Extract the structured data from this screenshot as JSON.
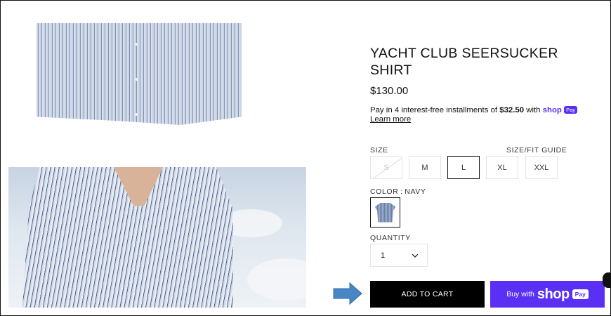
{
  "product": {
    "title_line1": "YACHT CLUB SEERSUCKER",
    "title_line2": "SHIRT",
    "price": "$130.00",
    "installments_pre": "Pay in 4 interest-free installments of ",
    "installments_amount": "$32.50",
    "installments_post": " with ",
    "installments_brand": "shop",
    "installments_brand_chip": "Pay",
    "learn_more": "Learn more"
  },
  "size": {
    "label": "SIZE",
    "guide_label": "SIZE/FIT GUIDE",
    "options": [
      {
        "label": "S",
        "state": "unavailable"
      },
      {
        "label": "M",
        "state": "available"
      },
      {
        "label": "L",
        "state": "selected"
      },
      {
        "label": "XL",
        "state": "available"
      },
      {
        "label": "XXL",
        "state": "available"
      }
    ]
  },
  "color": {
    "label": "COLOR : NAVY",
    "swatch_icon": "shirt-thumbnail"
  },
  "quantity": {
    "label": "QUANTITY",
    "value": "1"
  },
  "actions": {
    "add_to_cart": "ADD TO CART",
    "buy_with": "Buy with",
    "buy_brand": "shop",
    "buy_brand_chip": "Pay"
  },
  "colors": {
    "accent": "#5a31f4",
    "cart_bg": "#000000",
    "arrow": "#4a86c5"
  }
}
